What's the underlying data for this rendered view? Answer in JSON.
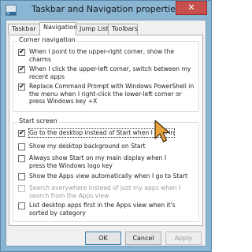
{
  "window": {
    "title": "Taskbar and Navigation properties",
    "close_symbol": "✕"
  },
  "tabs": [
    {
      "label": "Taskbar",
      "active": false
    },
    {
      "label": "Navigation",
      "active": true
    },
    {
      "label": "Jump Lists",
      "active": false
    },
    {
      "label": "Toolbars",
      "active": false
    }
  ],
  "corner_navigation": {
    "title": "Corner navigation",
    "options": [
      {
        "label": "When I point to the upper-right corner, show the charms",
        "checked": true,
        "enabled": true
      },
      {
        "label": "When I click the upper-left corner, switch between my recent apps",
        "checked": true,
        "enabled": true
      },
      {
        "label": "Replace Command Prompt with Windows PowerShell in the menu when I right-click the lower-left corner or press Windows key +X",
        "checked": true,
        "enabled": true
      }
    ]
  },
  "start_screen": {
    "title": "Start screen",
    "options": [
      {
        "label": "Go to the desktop instead of Start when I sign in",
        "checked": true,
        "enabled": true,
        "focused": true
      },
      {
        "label": "Show my desktop background on Start",
        "checked": false,
        "enabled": true
      },
      {
        "label": "Always show Start on my main display when I press the Windows logo key",
        "checked": false,
        "enabled": true
      },
      {
        "label": "Show the Apps view automatically when I go to Start",
        "checked": false,
        "enabled": true
      },
      {
        "label": "Search everywhere instead of just my apps when I search from the Apps view",
        "checked": false,
        "enabled": false
      },
      {
        "label": "List desktop apps first in the Apps view when it's sorted by category",
        "checked": false,
        "enabled": true
      }
    ]
  },
  "buttons": {
    "ok": "OK",
    "cancel": "Cancel",
    "apply": "Apply"
  },
  "check_glyph": "✔",
  "colors": {
    "title_bar": "#8ab5d3",
    "close_button": "#c7504f",
    "cursor": "#e8a33c"
  }
}
